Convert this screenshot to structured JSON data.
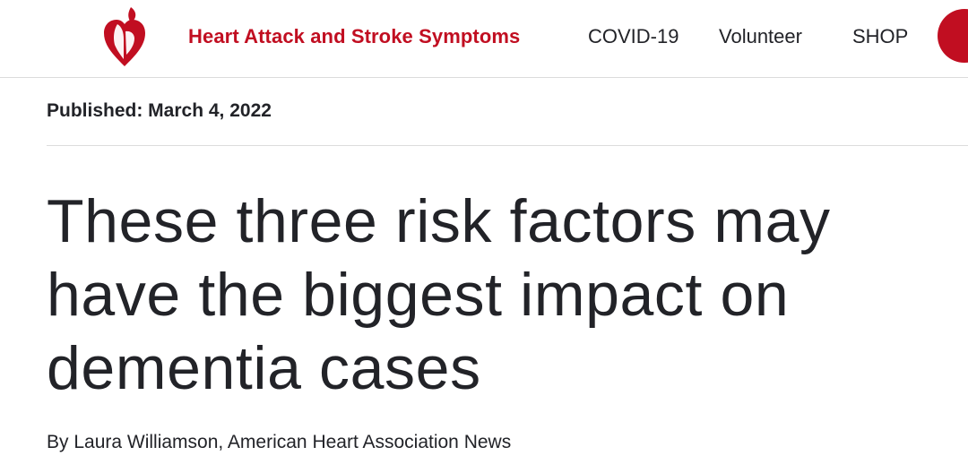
{
  "header": {
    "logo_icon": "heart-torch-logo-icon",
    "brand_color": "#c10e21",
    "nav": {
      "symptoms": "Heart Attack and Stroke Symptoms",
      "covid": "COVID-19",
      "volunteer": "Volunteer",
      "shop": "SHOP"
    }
  },
  "article": {
    "published": "Published: March 4, 2022",
    "headline": "These three risk factors may have the biggest impact on dementia cases",
    "byline": "By Laura Williamson, American Heart Association News"
  }
}
